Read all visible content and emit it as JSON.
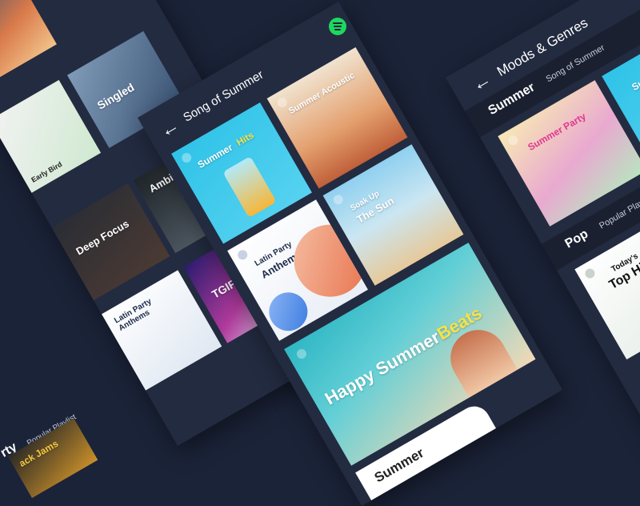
{
  "brand": {
    "accent": "#1ed760",
    "background": "#1b2338",
    "panel": "#232b40"
  },
  "left_panel": {
    "tiles": {
      "singled": "Singled",
      "early_bird": "Early Bird",
      "deep_focus": "Deep Focus",
      "ambient": "Ambient Ch",
      "latin": "Latin Party Anthems",
      "tgif": "TGIF",
      "jams": "ack Jams"
    },
    "section": {
      "title": "rty",
      "subtitle": "Popular Playlist"
    }
  },
  "center_panel": {
    "title": "Song of Summer",
    "back_icon": "arrow-left-icon",
    "logo": "spotify-logo-icon",
    "tiles": {
      "summer_hits_a": "Summer",
      "summer_hits_b": "Hits",
      "summer_acoustic": "Summer Acoustic",
      "latin_a": "Latin Party",
      "latin_b": "Anthems",
      "soak_a": "Soak Up",
      "soak_b": "The Sun",
      "happy_a": "Happy Summer",
      "happy_b": "Beats"
    },
    "bottom_label": "Summer"
  },
  "right_panel": {
    "title": "Moods & Genres",
    "back_icon": "arrow-left-icon",
    "breadcrumb": {
      "category": "Summer",
      "subtitle": "Song of Summer"
    },
    "tiles": {
      "summer_party": "Summer Party",
      "summer_cut": "Summe",
      "top_hits_a": "Today's",
      "top_hits_b": "Top Hits"
    },
    "section": {
      "title": "Pop",
      "subtitle": "Popular Playlis"
    }
  }
}
